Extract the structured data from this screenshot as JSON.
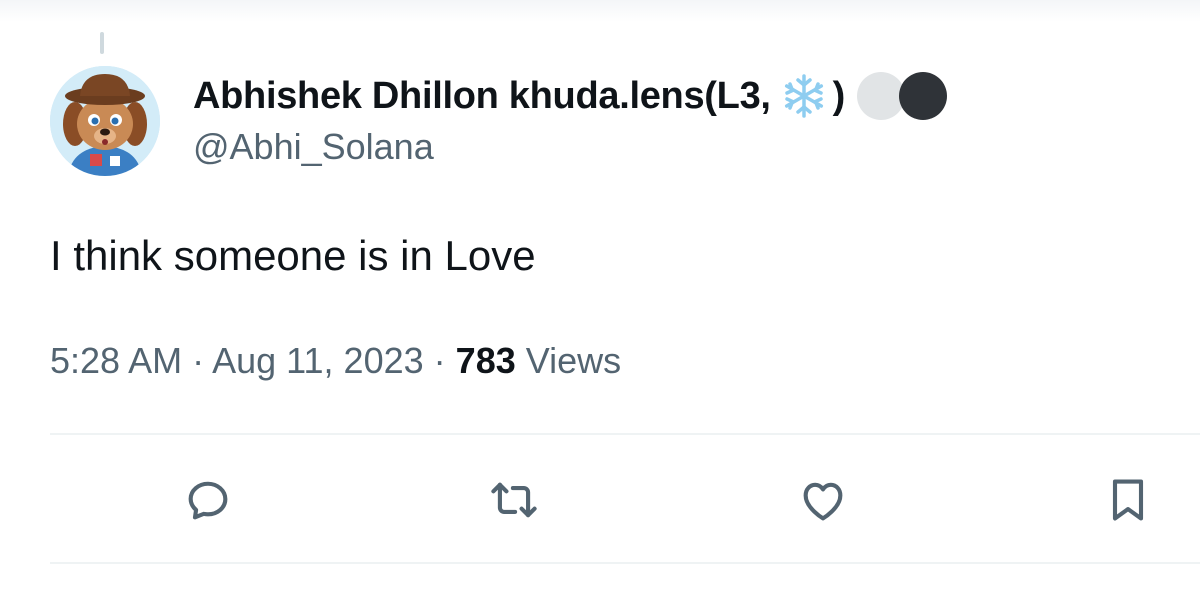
{
  "tweet": {
    "display_name": "Abhishek Dhillon khuda.lens(L3,",
    "name_suffix": ")",
    "handle": "@Abhi_Solana",
    "text": "I think someone is in Love",
    "time": "5:28 AM",
    "separator": "·",
    "date": "Aug 11, 2023",
    "views_count": "783",
    "views_label": "Views"
  },
  "icons": {
    "name_emoji": "snowflake-icon",
    "badges": [
      "gray-circle-icon",
      "black-circle-icon"
    ],
    "actions": [
      "reply-icon",
      "retweet-icon",
      "like-icon",
      "bookmark-icon"
    ]
  },
  "colors": {
    "text_primary": "#0f1419",
    "text_secondary": "#536471",
    "divider": "#eff3f4",
    "snowflake": "#8ecdf0"
  }
}
